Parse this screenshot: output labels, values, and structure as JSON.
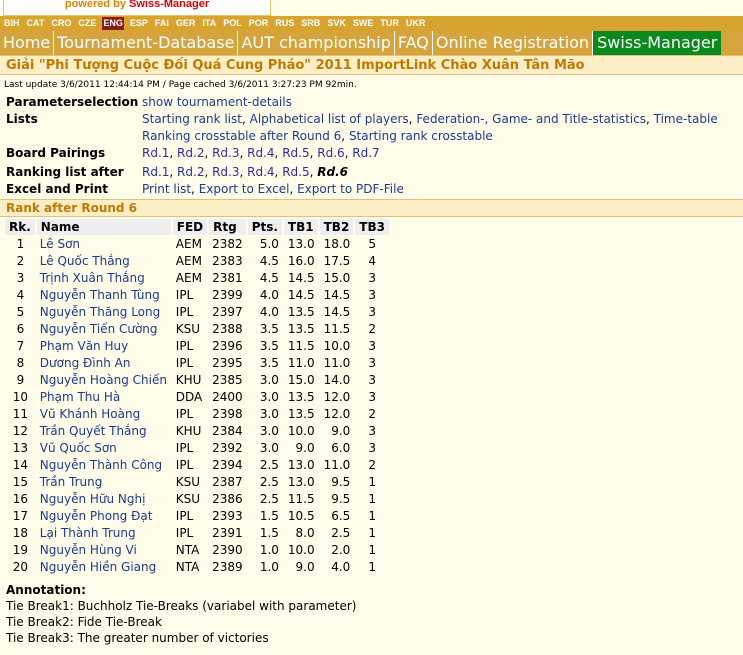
{
  "brand": {
    "line": "powered by ",
    "name": "Swiss-Manager"
  },
  "languages": [
    "BIH",
    "CAT",
    "CRO",
    "CZE",
    "ENG",
    "ESP",
    "FAI",
    "GER",
    "ITA",
    "POL",
    "POR",
    "RUS",
    "SRB",
    "SVK",
    "SWE",
    "TUR",
    "UKR"
  ],
  "active_language": "ENG",
  "nav": {
    "home": "Home",
    "tournament_db": "Tournament-Database",
    "aut": "AUT championship",
    "faq": "FAQ",
    "online_reg": "Online Registration",
    "swiss_manager": "Swiss-Manager"
  },
  "title": "Giải \"Phi Tượng Cuộc Đối Quá Cung Pháo\" 2011 ImportLink Chào Xuân Tân Mão",
  "last_update": "Last update 3/6/2011 12:44:14 PM / Page cached 3/6/2011 3:27:23 PM 92min.",
  "parameterselection": {
    "label": "Parameterselection",
    "link": "show tournament-details"
  },
  "lists": {
    "label": "Lists",
    "starting_rank": "Starting rank list",
    "alphabetical": "Alphabetical list of players",
    "federation": "Federation-, Game- and Title-statistics",
    "time_table": "Time-table",
    "ranking_crosstable": "Ranking crosstable after Round 6",
    "starting_crosstable": "Starting rank crosstable"
  },
  "board_pairings": {
    "label": "Board Pairings",
    "rounds": [
      "Rd.1",
      "Rd.2",
      "Rd.3",
      "Rd.4",
      "Rd.5",
      "Rd.6",
      "Rd.7"
    ]
  },
  "ranking_after": {
    "label": "Ranking list after",
    "rounds": [
      "Rd.1",
      "Rd.2",
      "Rd.3",
      "Rd.4",
      "Rd.5"
    ],
    "current": "Rd.6"
  },
  "excel_print": {
    "label": "Excel and Print",
    "print_list": "Print list",
    "export_excel": "Export to Excel",
    "export_pdf": "Export to PDF-File"
  },
  "rank_header": "Rank after Round 6",
  "table": {
    "headers": [
      "Rk.",
      "Name",
      "FED",
      "Rtg",
      "Pts.",
      "TB1",
      "TB2",
      "TB3"
    ],
    "rows": [
      [
        "1",
        "Lê Sơn",
        "AEM",
        "2382",
        "5.0",
        "13.0",
        "18.0",
        "5"
      ],
      [
        "2",
        "Lê Quốc Thắng",
        "AEM",
        "2383",
        "4.5",
        "16.0",
        "17.5",
        "4"
      ],
      [
        "3",
        "Trịnh Xuân Thắng",
        "AEM",
        "2381",
        "4.5",
        "14.5",
        "15.0",
        "3"
      ],
      [
        "4",
        "Nguyễn Thanh Tùng",
        "IPL",
        "2399",
        "4.0",
        "14.5",
        "14.5",
        "3"
      ],
      [
        "5",
        "Nguyễn Thăng Long",
        "IPL",
        "2397",
        "4.0",
        "13.5",
        "14.5",
        "3"
      ],
      [
        "6",
        "Nguyễn Tiến Cường",
        "KSU",
        "2388",
        "3.5",
        "13.5",
        "11.5",
        "2"
      ],
      [
        "7",
        "Phạm Văn Huy",
        "IPL",
        "2396",
        "3.5",
        "11.5",
        "10.0",
        "3"
      ],
      [
        "8",
        "Dương Đình An",
        "IPL",
        "2395",
        "3.5",
        "11.0",
        "11.0",
        "3"
      ],
      [
        "9",
        "Nguyễn Hoàng Chiến",
        "KHU",
        "2385",
        "3.0",
        "15.0",
        "14.0",
        "3"
      ],
      [
        "10",
        "Phạm Thu Hà",
        "DDA",
        "2400",
        "3.0",
        "13.5",
        "12.0",
        "3"
      ],
      [
        "11",
        "Vũ Khánh Hoàng",
        "IPL",
        "2398",
        "3.0",
        "13.5",
        "12.0",
        "2"
      ],
      [
        "12",
        "Trần Quyết Thắng",
        "KHU",
        "2384",
        "3.0",
        "10.0",
        "9.0",
        "3"
      ],
      [
        "13",
        "Vũ Quốc Sơn",
        "IPL",
        "2392",
        "3.0",
        "9.0",
        "6.0",
        "3"
      ],
      [
        "14",
        "Nguyễn Thành Công",
        "IPL",
        "2394",
        "2.5",
        "13.0",
        "11.0",
        "2"
      ],
      [
        "15",
        "Trần Trung",
        "KSU",
        "2387",
        "2.5",
        "13.0",
        "9.5",
        "1"
      ],
      [
        "16",
        "Nguyễn Hữu Nghị",
        "KSU",
        "2386",
        "2.5",
        "11.5",
        "9.5",
        "1"
      ],
      [
        "17",
        "Nguyễn Phong Đạt",
        "IPL",
        "2393",
        "1.5",
        "10.5",
        "6.5",
        "1"
      ],
      [
        "18",
        "Lại Thành Trung",
        "IPL",
        "2391",
        "1.5",
        "8.0",
        "2.5",
        "1"
      ],
      [
        "19",
        "Nguyễn Hùng Vi",
        "NTA",
        "2390",
        "1.0",
        "10.0",
        "2.0",
        "1"
      ],
      [
        "20",
        "Nguyễn Hiền Giang",
        "NTA",
        "2389",
        "1.0",
        "9.0",
        "4.0",
        "1"
      ]
    ]
  },
  "annotation": {
    "title": "Annotation:",
    "lines": [
      "Tie Break1: Buchholz Tie-Breaks (variabel with parameter)",
      "Tie Break2: Fide Tie-Break",
      "Tie Break3: The greater number of victories"
    ]
  },
  "colors": {
    "nav_bg": "#d6a43c",
    "swiss_manager_bg": "#0a8a1c",
    "title_color": "#c07900",
    "link_color": "#1e3a8c"
  }
}
